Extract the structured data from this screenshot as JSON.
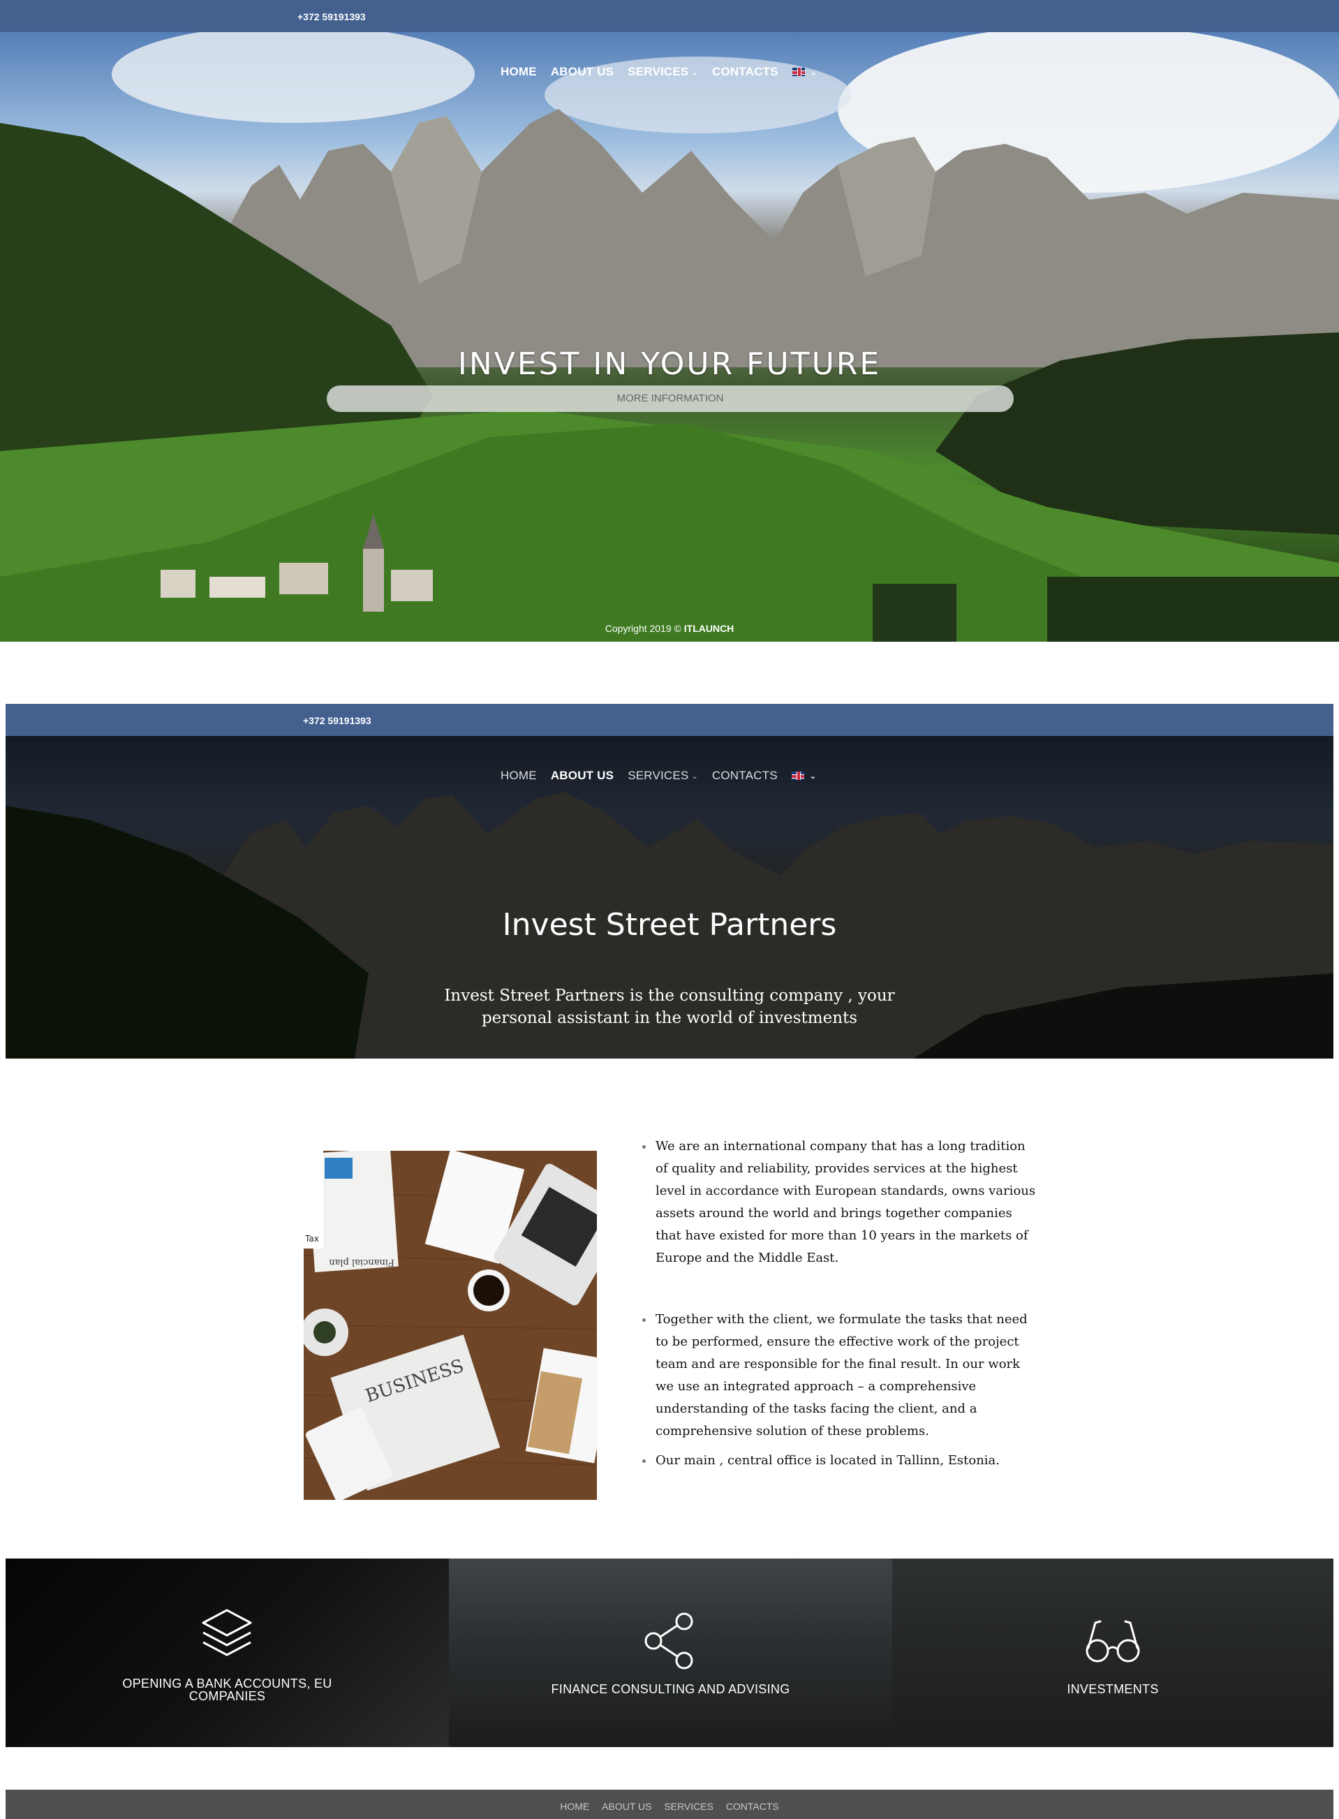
{
  "phone": "+372 59191393",
  "nav": {
    "home": "HOME",
    "about": "ABOUT US",
    "services": "SERVICES",
    "contacts": "CONTACTS"
  },
  "hero": {
    "title": "INVEST IN YOUR FUTURE",
    "button": "MORE INFORMATION",
    "copyright_prefix": "Copyright 2019 © ",
    "copyright_brand": "ITLAUNCH"
  },
  "about_hero": {
    "title": "Invest Street Partners",
    "subtitle": "Invest Street Partners is the consulting company , your personal assistant in the world of investments"
  },
  "about": {
    "bullets": [
      "We are an international company that has a long tradition of quality and reliability, provides services at the highest level in accordance with European standards, owns various assets around the world and brings together companies that have existed for more than 10 years in the markets of Europe and the Middle East.",
      "Together with the client, we formulate the tasks that need to be performed, ensure the effective work of the project team and are responsible for the final result. In our work we use an integrated approach – a comprehensive understanding of the tasks facing the client, and a comprehensive solution of these problems.",
      "Our main , central office is located in Tallinn, Estonia."
    ],
    "photo_texts": {
      "newspaper": "BUSINESS",
      "plan": "Financial plan",
      "tax": "Tax"
    }
  },
  "services": [
    {
      "label": "OPENING A BANK ACCOUNTS, EU COMPANIES",
      "icon": "layers-icon"
    },
    {
      "label": "FINANCE CONSULTING AND ADVISING",
      "icon": "share-icon"
    },
    {
      "label": "INVESTMENTS",
      "icon": "glasses-icon"
    }
  ],
  "footer": {
    "home": "HOME",
    "about": "ABOUT US",
    "services": "SERVICES",
    "contacts": "CONTACTS"
  },
  "colors": {
    "topbar": "#43608f",
    "footer": "#4f4f4f"
  }
}
